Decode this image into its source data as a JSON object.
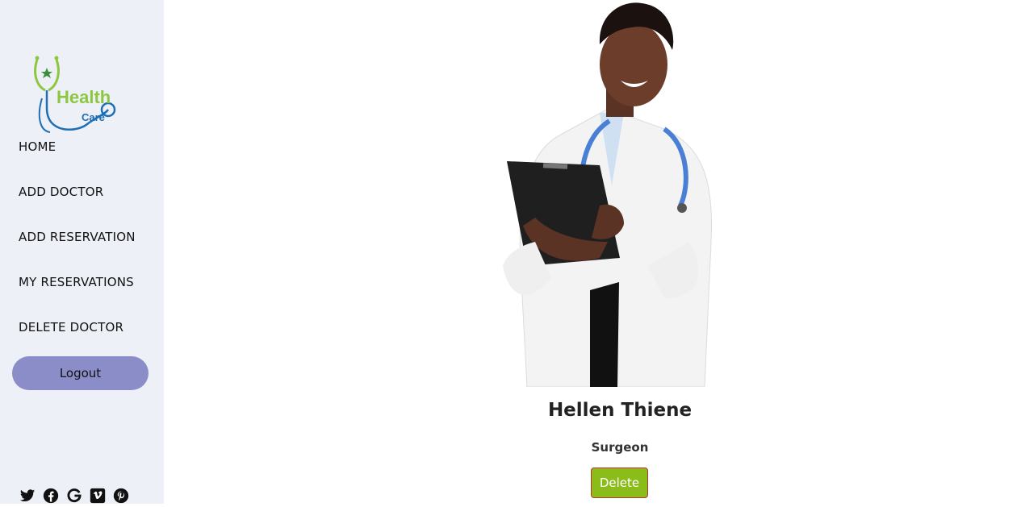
{
  "logo": {
    "line1": "Health",
    "line2": "Care",
    "icon": "stethoscope-logo"
  },
  "nav": {
    "items": [
      {
        "label": "HOME"
      },
      {
        "label": "ADD DOCTOR"
      },
      {
        "label": "ADD RESERVATION"
      },
      {
        "label": "MY RESERVATIONS"
      },
      {
        "label": "DELETE DOCTOR"
      }
    ],
    "logout_label": "Logout"
  },
  "social": [
    "twitter-icon",
    "facebook-icon",
    "google-icon",
    "vimeo-icon",
    "pinterest-icon"
  ],
  "doctor": {
    "name": "Hellen Thiene",
    "specialty": "Surgeon",
    "delete_label": "Delete",
    "photo": "doctor-photo"
  },
  "colors": {
    "sidebar_bg": "#eef0f8",
    "logout_bg": "#8b8dc8",
    "delete_bg": "#8bbd1a",
    "logo_green": "#8dc63f",
    "logo_blue": "#1e6fb4"
  }
}
